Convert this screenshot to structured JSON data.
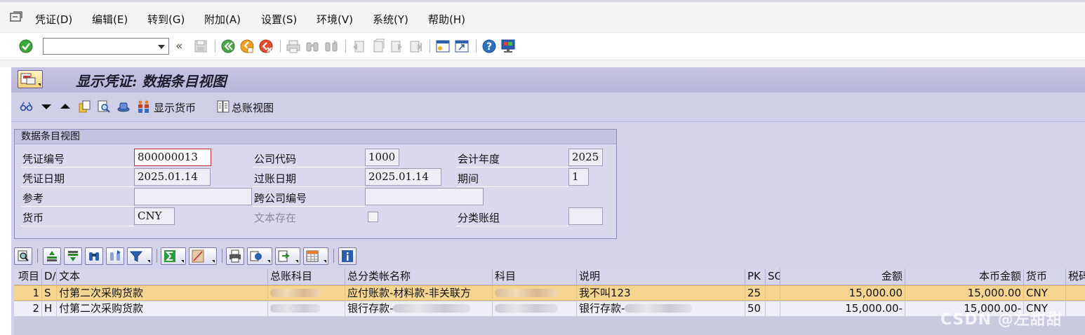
{
  "menu": [
    "凭证(D)",
    "编辑(E)",
    "转到(G)",
    "附加(A)",
    "设置(S)",
    "环境(V)",
    "系统(Y)",
    "帮助(H)"
  ],
  "toolbar": {
    "command_value": "",
    "back_label": "«"
  },
  "screen_title": "显示凭证: 数据条目视图",
  "app_toolbar": {
    "show_currency": "显示货币",
    "gl_view": "总账视图"
  },
  "header": {
    "group_title": "数据条目视图",
    "doc_no_label": "凭证编号",
    "doc_no": "800000013",
    "company_label": "公司代码",
    "company": "1000",
    "fiscal_year_label": "会计年度",
    "fiscal_year": "2025",
    "doc_date_label": "凭证日期",
    "doc_date": "2025.01.14",
    "posting_date_label": "过账日期",
    "posting_date": "2025.01.14",
    "period_label": "期间",
    "period": "1",
    "reference_label": "参考",
    "reference": "",
    "cross_company_label": "跨公司编号",
    "cross_company": "",
    "currency_label": "货币",
    "currency": "CNY",
    "text_exists_label": "文本存在",
    "text_exists": false,
    "ledger_group_label": "分类账组",
    "ledger_group": ""
  },
  "table": {
    "columns": [
      "项目",
      "D/",
      "文本",
      "总账科目",
      "总分类帐名称",
      "科目",
      "说明",
      "PK",
      "SG",
      "金额",
      "本币金额",
      "货币",
      "税码"
    ],
    "rows": [
      {
        "item": "1",
        "dc": "S",
        "text": "付第二次采购货款",
        "gl_account": "",
        "gl_name": "应付账款-材料款-非关联方",
        "account": "",
        "description": "我不叫123",
        "pk": "25",
        "sg": "",
        "amount": "15,000.00",
        "local_amount": "15,000.00",
        "currency": "CNY",
        "tax": "",
        "selected": true
      },
      {
        "item": "2",
        "dc": "H",
        "text": "付第二次采购货款",
        "gl_account": "",
        "gl_name": "银行存款-",
        "account": "",
        "description": "银行存款-",
        "pk": "50",
        "sg": "",
        "amount": "15,000.00-",
        "local_amount": "15,000.00-",
        "currency": "CNY",
        "tax": "",
        "selected": false
      }
    ]
  },
  "watermark": "CSDN @左甜甜",
  "colors": {
    "title_bar": "#c6c3e3",
    "work_area": "#d3d2ea",
    "selected_row": "#f6d590"
  }
}
